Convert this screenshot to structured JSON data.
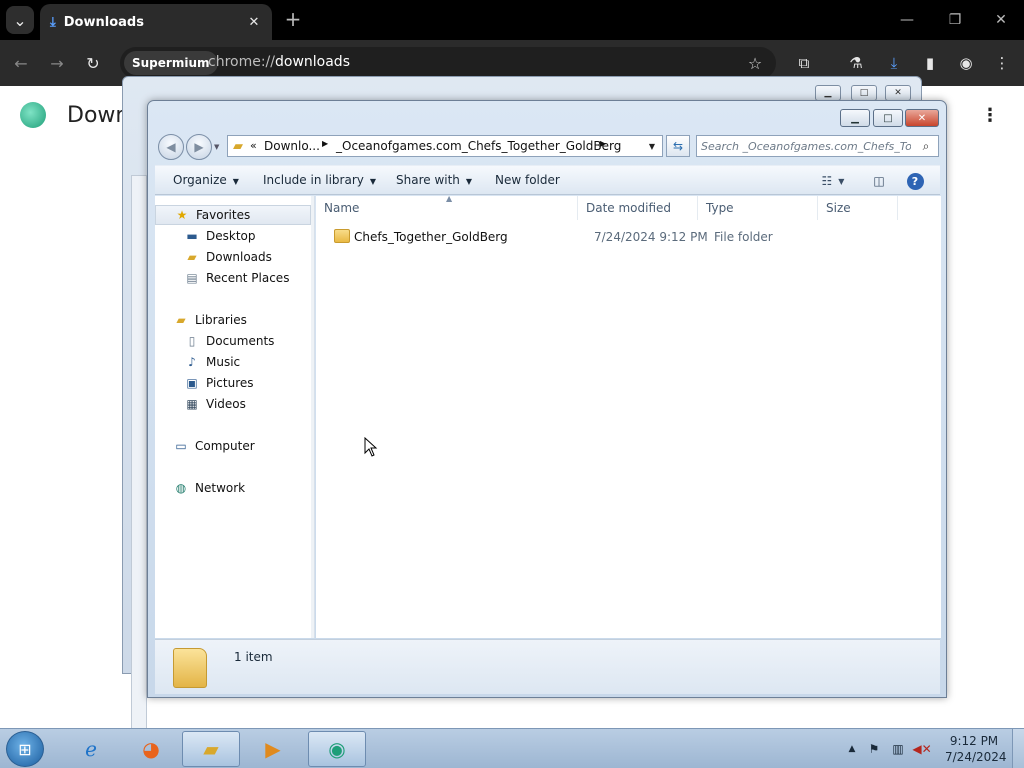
{
  "browser": {
    "tab_title": "Downloads",
    "site_chip": "Supermium",
    "url_scheme": "chrome://",
    "url_path": "downloads",
    "page_title": "Downloads"
  },
  "explorer": {
    "breadcrumb": [
      "Downlo...",
      "_Oceanofgames.com_Chefs_Together_GoldBerg"
    ],
    "search_placeholder": "Search _Oceanofgames.com_Chefs_To...",
    "toolbar": {
      "organize": "Organize",
      "include_in_library": "Include in library",
      "share_with": "Share with",
      "new_folder": "New folder"
    },
    "nav": {
      "favorites": "Favorites",
      "desktop": "Desktop",
      "downloads": "Downloads",
      "recent_places": "Recent Places",
      "libraries": "Libraries",
      "documents": "Documents",
      "music": "Music",
      "pictures": "Pictures",
      "videos": "Videos",
      "computer": "Computer",
      "network": "Network"
    },
    "columns": {
      "name": "Name",
      "date_modified": "Date modified",
      "type": "Type",
      "size": "Size"
    },
    "files": [
      {
        "name": "Chefs_Together_GoldBerg",
        "date_modified": "7/24/2024 9:12 PM",
        "type": "File folder",
        "size": ""
      }
    ],
    "details": "1 item"
  },
  "taskbar": {
    "time": "9:12 PM",
    "date": "7/24/2024"
  },
  "colors": {
    "browser_frame": "#000000",
    "browser_toolbar": "#2b2b2b",
    "explorer_frame": "#c8d8ea",
    "close_button": "#c8452c",
    "folder": "#e9b944",
    "taskbar": "#9db6d2"
  }
}
